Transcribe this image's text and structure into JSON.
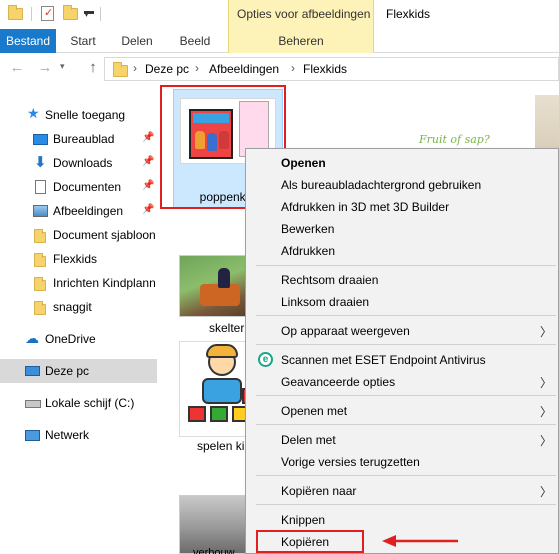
{
  "quick_access_toolbar": {
    "items": [
      "folder-icon",
      "properties-icon",
      "new-folder-icon",
      "customize-dropdown"
    ]
  },
  "contextual_tab_header": "Opties voor afbeeldingen",
  "window_title": "Flexkids",
  "ribbon": {
    "file_tab": "Bestand",
    "tabs": [
      "Start",
      "Delen",
      "Beeld"
    ],
    "contextual_tab": "Beheren"
  },
  "address_bar": {
    "breadcrumbs": [
      "Deze pc",
      "Afbeeldingen",
      "Flexkids"
    ]
  },
  "nav_pane": {
    "quick_access_label": "Snelle toegang",
    "items": [
      {
        "label": "Bureaublad",
        "icon": "desktop-icon",
        "pinned": true
      },
      {
        "label": "Downloads",
        "icon": "downloads-icon",
        "pinned": true
      },
      {
        "label": "Documenten",
        "icon": "documents-icon",
        "pinned": true
      },
      {
        "label": "Afbeeldingen",
        "icon": "pictures-icon",
        "pinned": true
      },
      {
        "label": "Document sjabloon",
        "icon": "folder-icon",
        "pinned": false
      },
      {
        "label": "Flexkids",
        "icon": "folder-icon",
        "pinned": false
      },
      {
        "label": "Inrichten Kindplann",
        "icon": "folder-icon",
        "pinned": false
      },
      {
        "label": "snaggit",
        "icon": "folder-icon",
        "pinned": false
      }
    ],
    "onedrive": "OneDrive",
    "this_pc": "Deze pc",
    "local_disk": "Lokale schijf (C:)",
    "network": "Netwerk"
  },
  "files": {
    "selected_file": "poppenkas",
    "file2": "skelter",
    "file3": "spelen ki",
    "file4": "verbouw",
    "fruit_text": "Fruit of sap?"
  },
  "context_menu": {
    "items": [
      {
        "label": "Openen",
        "bold": true
      },
      {
        "label": "Als bureaubladachtergrond gebruiken"
      },
      {
        "label": "Afdrukken in 3D met 3D Builder"
      },
      {
        "label": "Bewerken"
      },
      {
        "label": "Afdrukken"
      },
      {
        "label": "Rechtsom draaien"
      },
      {
        "label": "Linksom draaien"
      },
      {
        "label": "Op apparaat weergeven",
        "submenu": true
      },
      {
        "label": "Scannen met ESET Endpoint Antivirus",
        "icon": "eset-icon"
      },
      {
        "label": "Geavanceerde opties",
        "submenu": true
      },
      {
        "label": "Openen met",
        "submenu": true
      },
      {
        "label": "Delen met",
        "submenu": true
      },
      {
        "label": "Vorige versies terugzetten"
      },
      {
        "label": "Kopiëren naar",
        "submenu": true
      },
      {
        "label": "Knippen"
      },
      {
        "label": "Kopiëren",
        "highlighted": true
      }
    ]
  },
  "colors": {
    "file_tab": "#1979ca",
    "contextual_tab": "#fdf3b8",
    "selection": "#cce8ff",
    "annotation": "#e02020"
  }
}
